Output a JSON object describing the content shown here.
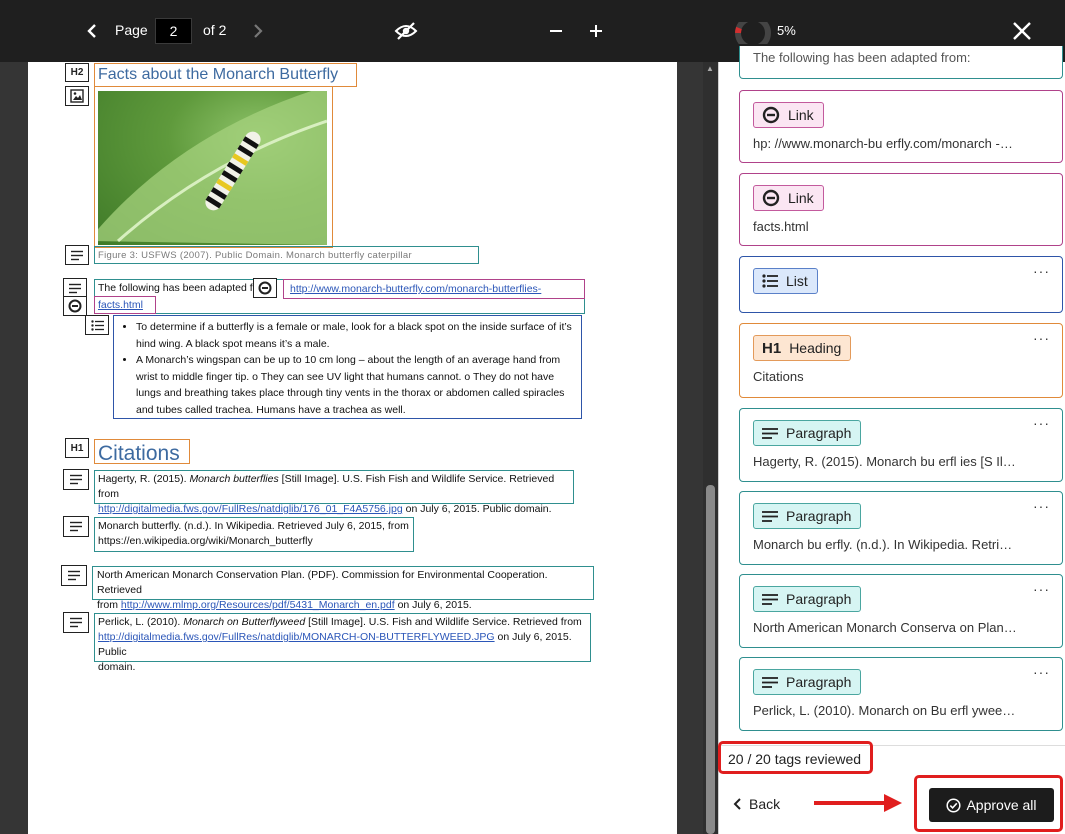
{
  "toolbar": {
    "page_label": "Page",
    "page_value": "2",
    "of_label": "of 2",
    "progress_percent": "5%",
    "progress_fraction": 0.05
  },
  "document": {
    "h2_badge": "H2",
    "h2_title": "Facts about the Monarch Butterfly",
    "caption": "Figure 3: USFWS (2007). Public Domain. Monarch butterfly caterpillar",
    "para_intro": "The following has been adapted from:",
    "link_url_1": "http://www.monarch-butterfly.com/monarch-butterflies-",
    "link_url_2": "facts.html",
    "bullet_1": "To determine if a butterfly is a female or male, look for a black spot on the inside surface of it’s hind wing. A black spot means it’s a male.",
    "bullet_2": "A Monarch’s wingspan can be up to 10 cm long – about the length of an average hand from wrist to middle finger tip. o They can see UV light that humans cannot. o They do not have lungs and breathing takes place through tiny vents in the thorax or abdomen called spiracles and tubes called trachea. Humans have a trachea as well.",
    "h1_badge": "H1",
    "h1_title": "Citations",
    "cite1_a": "Hagerty, R. (2015). ",
    "cite1_b": "Monarch butterflies",
    "cite1_c": " [Still Image]. U.S. Fish Fish and Wildlife Service. Retrieved from",
    "cite1_link": "http://digitalmedia.fws.gov/FullRes/natdiglib/176_01_F4A5756.jpg",
    "cite1_d": " on July 6, 2015. Public domain.",
    "cite2_a": "Monarch butterfly. (n.d.). In Wikipedia. Retrieved July 6, 2015, from",
    "cite2_b": "https://en.wikipedia.org/wiki/Monarch_butterfly",
    "cite3_a": "North American Monarch Conservation Plan. (PDF). Commission for Environmental Cooperation. Retrieved",
    "cite3_b": "from ",
    "cite3_link": "http://www.mlmp.org/Resources/pdf/5431_Monarch_en.pdf",
    "cite3_c": " on July 6, 2015.",
    "cite4_a": "Perlick, L. (2010). ",
    "cite4_b": "Monarch on Butterflyweed",
    "cite4_c": " [Still Image]. U.S. Fish and Wildlife Service. Retrieved from",
    "cite4_link": "http://digitalmedia.fws.gov/FullRes/natdiglib/MONARCH-ON-BUTTERFLYWEED.JPG",
    "cite4_d": " on July 6, 2015. Public",
    "cite4_e": "domain."
  },
  "panel": {
    "top_partial": "The following has been adapted from:",
    "cards": [
      {
        "type": "Link",
        "desc": "hp: //www.monarch-bu erfly.com/monarch -…"
      },
      {
        "type": "Link",
        "desc": "facts.html"
      },
      {
        "type": "List",
        "desc": ""
      },
      {
        "type": "Heading",
        "icon": "H1",
        "desc": "Citations"
      },
      {
        "type": "Paragraph",
        "desc": "Hagerty, R. (2015). Monarch bu erfl ies [S Il…"
      },
      {
        "type": "Paragraph",
        "desc": "Monarch bu erfly. (n.d.). In Wikipedia. Retri…"
      },
      {
        "type": "Paragraph",
        "desc": "North American Monarch Conserva on Plan…"
      },
      {
        "type": "Paragraph",
        "desc": "Perlick, L. (2010). Monarch on Bu erfl ywee…"
      }
    ],
    "more_label": "···",
    "reviewed": "20 / 20 tags reviewed",
    "back_label": "Back",
    "approve_label": "Approve all"
  },
  "colors": {
    "heading": "#e08a3a",
    "paragraph": "#2f8f8f",
    "link": "#b0428a",
    "list": "#2e55a8",
    "highlight": "#e01e1e"
  }
}
